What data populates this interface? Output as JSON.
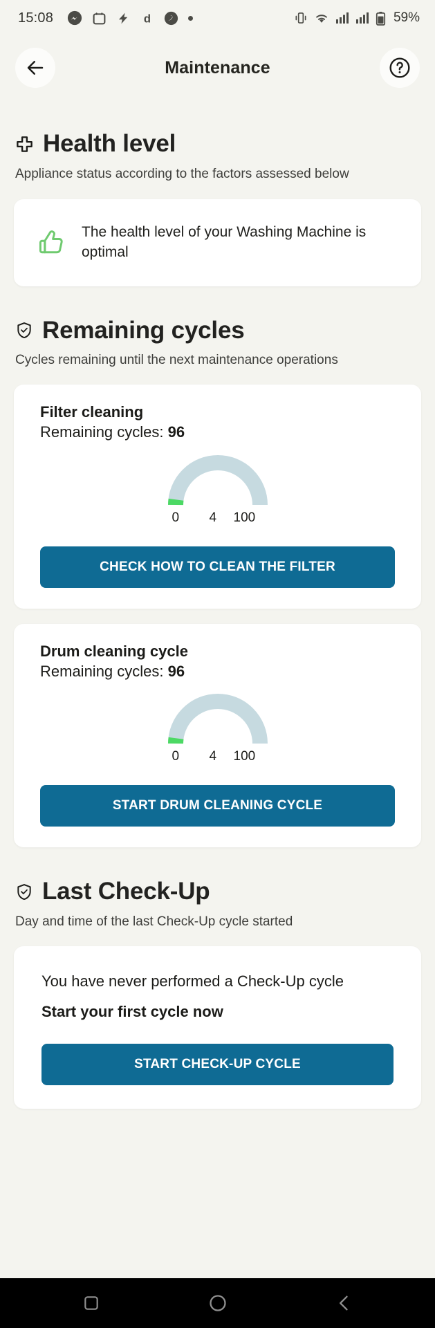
{
  "statusbar": {
    "time": "15:08",
    "battery_percent": "59%",
    "left_icons": [
      "messenger-icon",
      "calendar-icon",
      "lightning-icon",
      "d-app-icon",
      "swirl-app-icon",
      "more-dot-icon"
    ],
    "right_icons": [
      "vibrate-icon",
      "wifi-icon",
      "signal-sim1-icon",
      "signal-sim2-icon",
      "battery-icon"
    ]
  },
  "header": {
    "title": "Maintenance",
    "back_icon": "arrow-left-icon",
    "help_icon": "question-mark-icon"
  },
  "health": {
    "icon": "cross-health-icon",
    "title": "Health level",
    "subtitle": "Appliance status according to the factors assessed below",
    "status_icon": "thumbs-up-icon",
    "status_color": "#6fca6f",
    "status_text": "The health level of your Washing Machine is optimal"
  },
  "remaining_cycles": {
    "icon": "shield-check-icon",
    "title": "Remaining cycles",
    "subtitle": "Cycles remaining until the next maintenance operations",
    "cards": [
      {
        "title": "Filter cleaning",
        "remaining_label": "Remaining cycles:",
        "remaining_value": "96",
        "gauge": {
          "min": "0",
          "value": "4",
          "max": "100"
        },
        "button_label": "CHECK HOW TO CLEAN THE FILTER"
      },
      {
        "title": "Drum cleaning cycle",
        "remaining_label": "Remaining cycles:",
        "remaining_value": "96",
        "gauge": {
          "min": "0",
          "value": "4",
          "max": "100"
        },
        "button_label": "START DRUM CLEANING CYCLE"
      }
    ]
  },
  "last_checkup": {
    "icon": "shield-check-icon",
    "title": "Last Check-Up",
    "subtitle": "Day and time of the last Check-Up cycle started",
    "message_line1": "You have never performed a Check-Up cycle",
    "message_line2": "Start your first cycle now",
    "button_label": "START CHECK-UP CYCLE"
  },
  "navbar": {
    "recents_icon": "square-recents-icon",
    "home_icon": "circle-home-icon",
    "back_icon": "chevron-back-icon"
  },
  "colors": {
    "accent_blue": "#0f6b94",
    "gauge_track": "#c6dae0",
    "gauge_value": "#4cd964",
    "page_bg": "#f4f4ef",
    "card_bg": "#ffffff"
  },
  "chart_data": [
    {
      "type": "gauge",
      "title": "Filter cleaning",
      "value": 4,
      "min": 0,
      "max": 100,
      "unit": "cycles",
      "track_color": "#c6dae0",
      "value_color": "#4cd964",
      "tick_labels": [
        "0",
        "4",
        "100"
      ]
    },
    {
      "type": "gauge",
      "title": "Drum cleaning cycle",
      "value": 4,
      "min": 0,
      "max": 100,
      "unit": "cycles",
      "track_color": "#c6dae0",
      "value_color": "#4cd964",
      "tick_labels": [
        "0",
        "4",
        "100"
      ]
    }
  ]
}
